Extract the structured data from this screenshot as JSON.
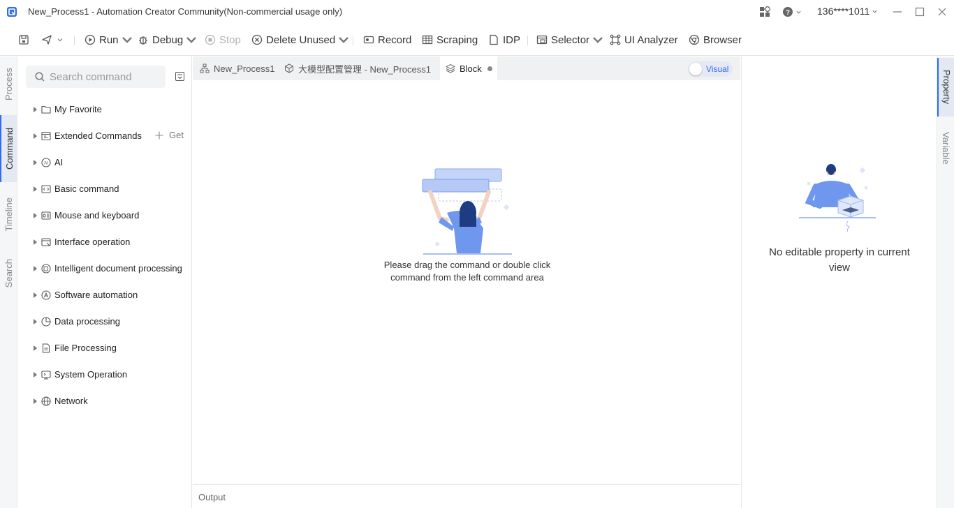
{
  "window": {
    "title": "New_Process1 - Automation Creator Community(Non-commercial usage only)",
    "user": "136****1011"
  },
  "toolbar": {
    "run": "Run",
    "debug": "Debug",
    "stop": "Stop",
    "delete_unused": "Delete Unused",
    "record": "Record",
    "scraping": "Scraping",
    "idp": "IDP",
    "selector": "Selector",
    "ui_analyzer": "UI Analyzer",
    "browser": "Browser"
  },
  "left_rail": {
    "tabs": [
      "Process",
      "Command",
      "Timeline",
      "Search"
    ],
    "active": "Command"
  },
  "command_panel": {
    "search_placeholder": "Search command",
    "get_label": "Get",
    "items": [
      {
        "label": "My Favorite",
        "icon": "folder-icon"
      },
      {
        "label": "Extended Commands",
        "icon": "extension-icon"
      },
      {
        "label": "AI",
        "icon": "ai-icon"
      },
      {
        "label": "Basic command",
        "icon": "code-icon"
      },
      {
        "label": "Mouse and keyboard",
        "icon": "keyboard-icon"
      },
      {
        "label": "Interface operation",
        "icon": "window-icon"
      },
      {
        "label": "Intelligent document processing",
        "icon": "document-ai-icon"
      },
      {
        "label": "Software automation",
        "icon": "automation-icon"
      },
      {
        "label": "Data processing",
        "icon": "pie-chart-icon"
      },
      {
        "label": "File Processing",
        "icon": "file-icon"
      },
      {
        "label": "System Operation",
        "icon": "system-icon"
      },
      {
        "label": "Network",
        "icon": "globe-icon"
      }
    ]
  },
  "editor": {
    "tabs": [
      {
        "label": "New_Process1",
        "icon": "flow-icon"
      },
      {
        "label": "大模型配置管理 - New_Process1",
        "icon": "cube-icon"
      },
      {
        "label": "Block",
        "icon": "layers-icon"
      }
    ],
    "active_tab": "Block",
    "visual_toggle": "Visual",
    "empty_hint": "Please drag the command or double click command from the left command area",
    "output_label": "Output"
  },
  "property_panel": {
    "empty_text": "No editable property in current view"
  },
  "right_rail": {
    "tabs": [
      "Property",
      "Variable"
    ],
    "active": "Property"
  },
  "colors": {
    "accent": "#2f6bf4",
    "illustration": "#6f97ee"
  }
}
